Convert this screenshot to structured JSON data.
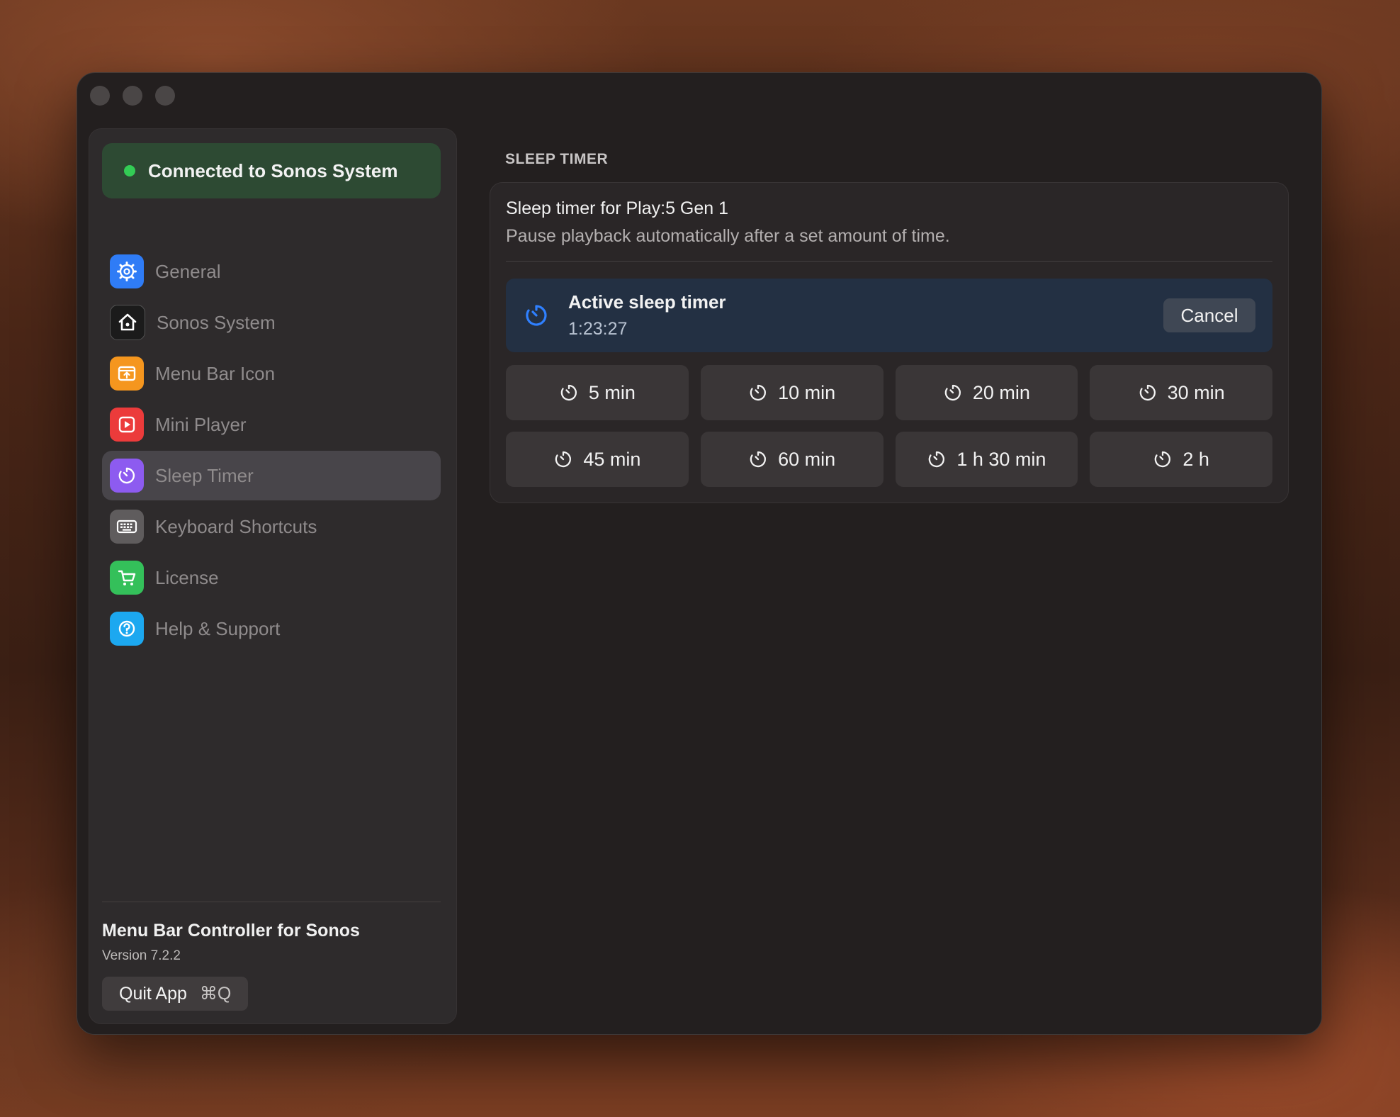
{
  "window": {
    "traffic_lights": [
      "close",
      "minimize",
      "zoom"
    ]
  },
  "sidebar": {
    "status": {
      "label": "Connected to Sonos System",
      "color": "#33cc55"
    },
    "items": [
      {
        "id": "general",
        "label": "General",
        "icon": "gear-icon",
        "color": "#2f7cf6",
        "active": false
      },
      {
        "id": "sonos-system",
        "label": "Sonos System",
        "icon": "home-icon",
        "color": "#1b1b1b",
        "active": false
      },
      {
        "id": "menu-bar-icon",
        "label": "Menu Bar Icon",
        "icon": "menubar-upload-icon",
        "color": "#f5961e",
        "active": false
      },
      {
        "id": "mini-player",
        "label": "Mini Player",
        "icon": "play-icon",
        "color": "#ec3b3b",
        "active": false
      },
      {
        "id": "sleep-timer",
        "label": "Sleep Timer",
        "icon": "timer-icon",
        "color": "#8d5bf0",
        "active": true
      },
      {
        "id": "keyboard-shortcuts",
        "label": "Keyboard Shortcuts",
        "icon": "keyboard-icon",
        "color": "#5f5c5d",
        "active": false
      },
      {
        "id": "license",
        "label": "License",
        "icon": "cart-icon",
        "color": "#34c05a",
        "active": false
      },
      {
        "id": "help-support",
        "label": "Help & Support",
        "icon": "question-icon",
        "color": "#1ca8f0",
        "active": false
      }
    ],
    "footer": {
      "app_name": "Menu Bar Controller for Sonos",
      "version": "Version 7.2.2",
      "quit_label": "Quit App",
      "quit_shortcut": "⌘Q"
    }
  },
  "main": {
    "section_title": "SLEEP TIMER",
    "card": {
      "title": "Sleep timer for Play:5 Gen 1",
      "subtitle": "Pause playback automatically after a set amount of time.",
      "active": {
        "title": "Active sleep timer",
        "time": "1:23:27",
        "cancel_label": "Cancel",
        "accent": "#2f80ff"
      },
      "presets": [
        {
          "label": "5 min"
        },
        {
          "label": "10 min"
        },
        {
          "label": "20 min"
        },
        {
          "label": "30 min"
        },
        {
          "label": "45 min"
        },
        {
          "label": "60 min"
        },
        {
          "label": "1 h 30 min"
        },
        {
          "label": "2 h"
        }
      ]
    }
  }
}
